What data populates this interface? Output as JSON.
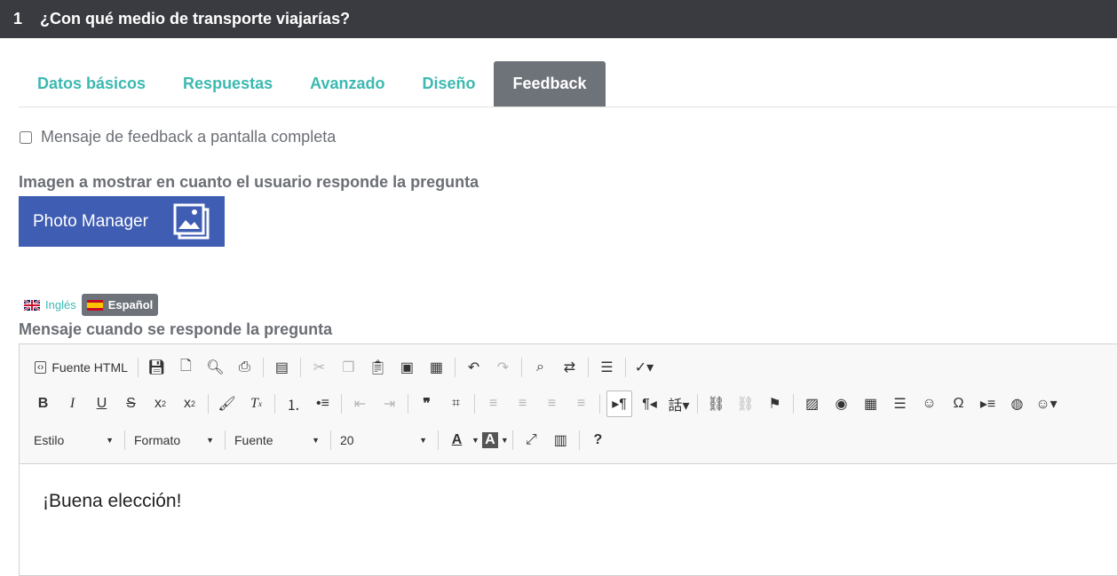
{
  "header": {
    "number": "1",
    "title": "¿Con qué medio de transporte viajarías?"
  },
  "tabs": [
    {
      "label": "Datos básicos",
      "active": false
    },
    {
      "label": "Respuestas",
      "active": false
    },
    {
      "label": "Avanzado",
      "active": false
    },
    {
      "label": "Diseño",
      "active": false
    },
    {
      "label": "Feedback",
      "active": true
    }
  ],
  "fullscreen_checkbox": {
    "label": "Mensaje de feedback a pantalla completa",
    "checked": false
  },
  "image_section": {
    "label": "Imagen a mostrar en cuanto el usuario responde la pregunta",
    "button_label": "Photo Manager"
  },
  "languages": [
    {
      "label": "Inglés",
      "active": false
    },
    {
      "label": "Español",
      "active": true
    }
  ],
  "message_section": {
    "label": "Mensaje cuando se responde la pregunta"
  },
  "toolbar": {
    "source_label": "Fuente HTML",
    "bold": "B",
    "italic": "I",
    "underline": "U",
    "strike": "S",
    "sub_base": "x",
    "sub_mark": "2",
    "sup_base": "x",
    "sup_mark": "2",
    "remove_format": "T",
    "remove_format_mark": "x",
    "style_label": "Estilo",
    "format_label": "Formato",
    "font_label": "Fuente",
    "size_label": "20",
    "text_color": "A",
    "bg_color": "A",
    "help": "?"
  },
  "editor": {
    "content": "¡Buena elección!"
  },
  "colors": {
    "header_bg": "#3a3b40",
    "accent": "#3cb9b0",
    "tab_active_bg": "#6e737a",
    "photo_button_bg": "#3f5db3"
  }
}
